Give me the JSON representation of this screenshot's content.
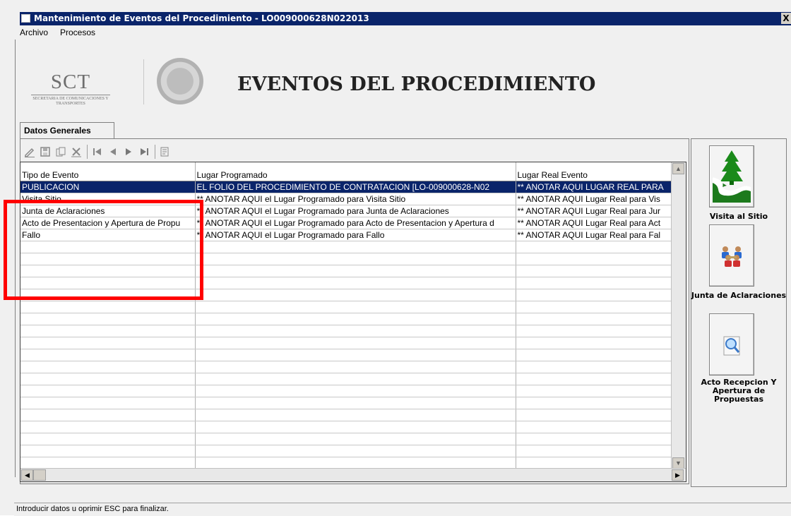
{
  "window": {
    "title": "Mantenimiento de Eventos del Procedimiento - LO009000628N022013",
    "close_glyph": "X"
  },
  "menu": {
    "items": [
      "Archivo",
      "Procesos"
    ]
  },
  "header": {
    "logo_text": "SCT",
    "logo_subtext": "SECRETARIA DE COMUNICACIONES Y TRANSPORTES",
    "title": "EVENTOS DEL PROCEDIMIENTO"
  },
  "tabs": [
    {
      "label": "Datos Generales",
      "active": true
    }
  ],
  "toolbar": {
    "icons": [
      "edit-icon",
      "save-icon",
      "copy-icon",
      "delete-icon",
      "first-record-icon",
      "prev-record-icon",
      "next-record-icon",
      "last-record-icon",
      "report-icon"
    ]
  },
  "grid": {
    "columns": [
      "Tipo de Evento",
      "Lugar Programado",
      "Lugar Real Evento"
    ],
    "rows": [
      [
        "PUBLICACION",
        "EL FOLIO DEL PROCEDIMIENTO DE CONTRATACION [LO-009000628-N02",
        "** ANOTAR AQUI LUGAR REAL PARA"
      ],
      [
        "Visita Sitio",
        "** ANOTAR AQUI el Lugar Programado para Visita Sitio",
        "** ANOTAR AQUI Lugar Real para Vis"
      ],
      [
        "Junta de Aclaraciones",
        "** ANOTAR AQUI el Lugar Programado para Junta de Aclaraciones",
        "** ANOTAR AQUI Lugar Real para Jur"
      ],
      [
        "Acto de Presentacion y Apertura de Propu",
        "** ANOTAR AQUI el Lugar Programado para Acto de Presentacion y Apertura d",
        "** ANOTAR AQUI Lugar Real para Act"
      ],
      [
        "Fallo",
        "** ANOTAR AQUI el Lugar Programado para Fallo",
        "** ANOTAR AQUI Lugar Real para Fal"
      ]
    ],
    "selected_row": 0
  },
  "side_buttons": [
    {
      "label": "Visita al Sitio",
      "icon": "forest-road-icon"
    },
    {
      "label": "Junta de Aclaraciones",
      "icon": "meeting-people-icon"
    },
    {
      "label": "Acto Recepcion Y Apertura de Propuestas",
      "icon": "magnifier-icon"
    }
  ],
  "status": {
    "text": "Introducir datos u oprimir ESC para finalizar."
  },
  "colors": {
    "titlebar": "#0a246a",
    "highlight": "#ff0000",
    "selection": "#0a246a"
  }
}
